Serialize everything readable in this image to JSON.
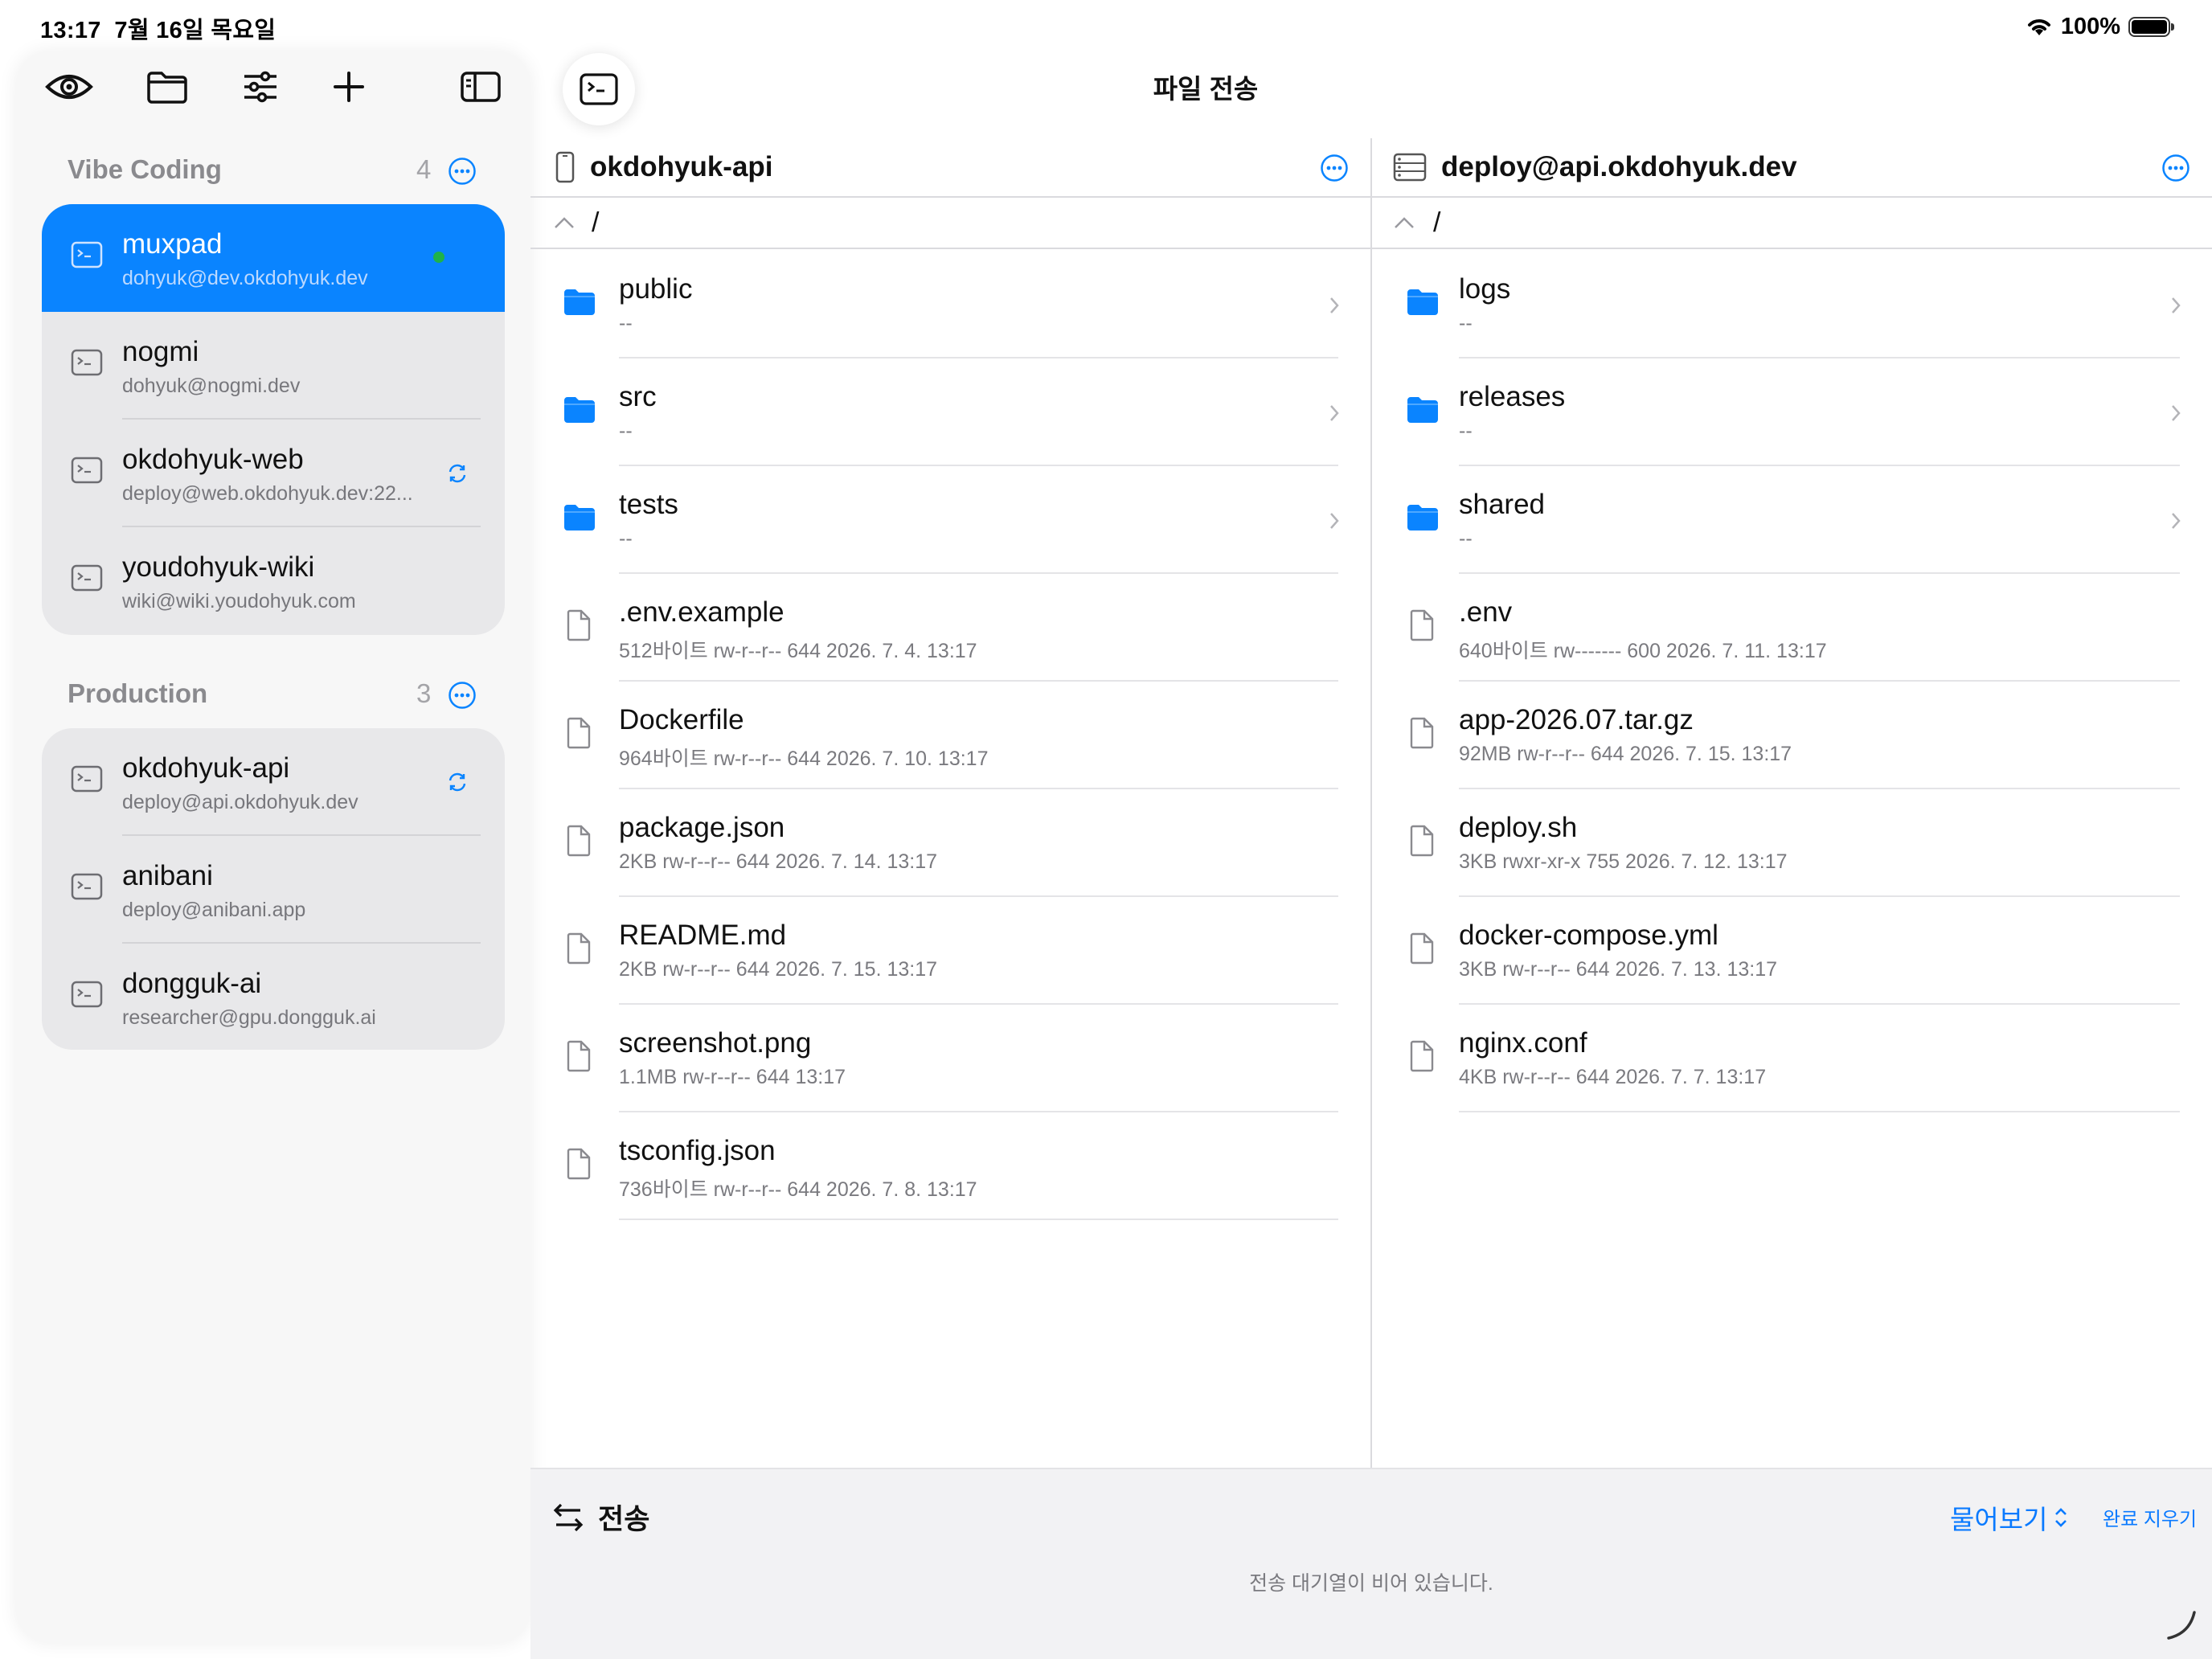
{
  "status_bar": {
    "time": "13:17",
    "date": "7월 16일 목요일",
    "battery": "100%"
  },
  "toolbar": {
    "icons": [
      "eye-icon",
      "folder-icon",
      "sliders-icon",
      "plus-icon",
      "sidebar-toggle-icon"
    ]
  },
  "groups": [
    {
      "title": "Vibe Coding",
      "count": "4",
      "items": [
        {
          "name": "muxpad",
          "host": "dohyuk@dev.okdohyuk.dev",
          "selected": true,
          "status": "connected"
        },
        {
          "name": "nogmi",
          "host": "dohyuk@nogmi.dev"
        },
        {
          "name": "okdohyuk-web",
          "host": "deploy@web.okdohyuk.dev:22...",
          "status": "syncing"
        },
        {
          "name": "youdohyuk-wiki",
          "host": "wiki@wiki.youdohyuk.com"
        }
      ]
    },
    {
      "title": "Production",
      "count": "3",
      "items": [
        {
          "name": "okdohyuk-api",
          "host": "deploy@api.okdohyuk.dev",
          "status": "syncing"
        },
        {
          "name": "anibani",
          "host": "deploy@anibani.app"
        },
        {
          "name": "dongguk-ai",
          "host": "researcher@gpu.dongguk.ai"
        }
      ]
    }
  ],
  "main": {
    "title": "파일 전송"
  },
  "left_pane": {
    "title": "okdohyuk-api",
    "path": "/",
    "files": [
      {
        "name": "public",
        "meta": "--",
        "type": "folder"
      },
      {
        "name": "src",
        "meta": "--",
        "type": "folder"
      },
      {
        "name": "tests",
        "meta": "--",
        "type": "folder"
      },
      {
        "name": ".env.example",
        "meta": "512바이트   rw-r--r-- 644   2026. 7. 4. 13:17",
        "type": "file"
      },
      {
        "name": "Dockerfile",
        "meta": "964바이트   rw-r--r-- 644   2026. 7. 10. 13:17",
        "type": "file"
      },
      {
        "name": "package.json",
        "meta": "2KB   rw-r--r-- 644   2026. 7. 14. 13:17",
        "type": "file"
      },
      {
        "name": "README.md",
        "meta": "2KB   rw-r--r-- 644   2026. 7. 15. 13:17",
        "type": "file"
      },
      {
        "name": "screenshot.png",
        "meta": "1.1MB   rw-r--r-- 644   13:17",
        "type": "file"
      },
      {
        "name": "tsconfig.json",
        "meta": "736바이트   rw-r--r-- 644   2026. 7. 8. 13:17",
        "type": "file"
      }
    ]
  },
  "right_pane": {
    "title": "deploy@api.okdohyuk.dev",
    "path": "/",
    "files": [
      {
        "name": "logs",
        "meta": "--",
        "type": "folder"
      },
      {
        "name": "releases",
        "meta": "--",
        "type": "folder"
      },
      {
        "name": "shared",
        "meta": "--",
        "type": "folder"
      },
      {
        "name": ".env",
        "meta": "640바이트   rw------- 600   2026. 7. 11. 13:17",
        "type": "file"
      },
      {
        "name": "app-2026.07.tar.gz",
        "meta": "92MB   rw-r--r-- 644   2026. 7. 15. 13:17",
        "type": "file"
      },
      {
        "name": "deploy.sh",
        "meta": "3KB   rwxr-xr-x 755   2026. 7. 12. 13:17",
        "type": "file"
      },
      {
        "name": "docker-compose.yml",
        "meta": "3KB   rw-r--r-- 644   2026. 7. 13. 13:17",
        "type": "file"
      },
      {
        "name": "nginx.conf",
        "meta": "4KB   rw-r--r-- 644   2026. 7. 7. 13:17",
        "type": "file"
      }
    ]
  },
  "transfer": {
    "title": "전송",
    "sort_label": "물어보기",
    "clear_label": "완료 지우기",
    "empty_message": "전송 대기열이 비어 있습니다."
  },
  "colors": {
    "accent": "#0a84ff",
    "connected": "#1fb24a"
  }
}
